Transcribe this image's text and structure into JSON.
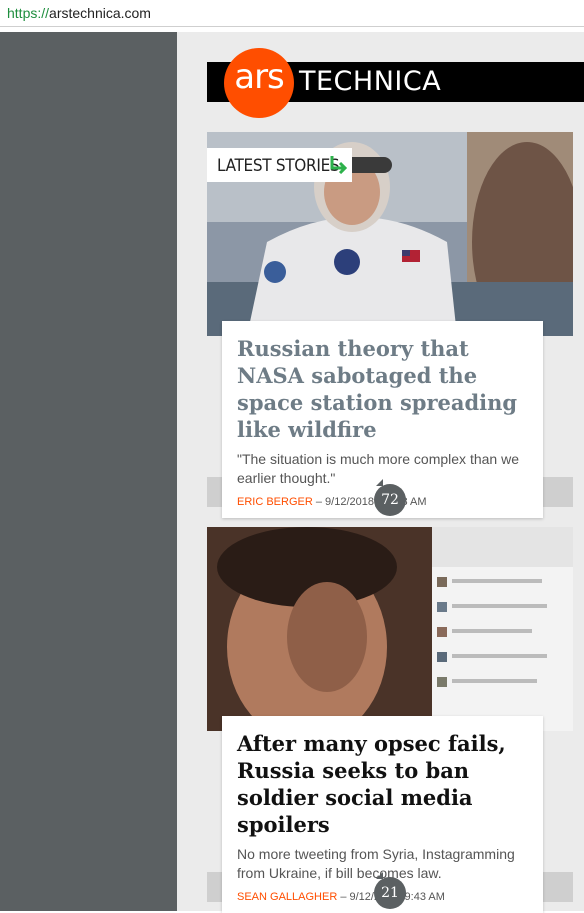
{
  "browser": {
    "url_scheme": "https://",
    "url_host": "arstechnica.com"
  },
  "logo": {
    "ars": "ars",
    "technica": "TECHNICA"
  },
  "section_label": "LATEST STORIES",
  "colors": {
    "brand_orange": "#ff4e00",
    "sidebar": "#5b6062"
  },
  "articles": [
    {
      "headline": "Russian theory that NASA sabotaged the space station spreading like wildfire",
      "dek": "\"The situation is much more complex than we earlier thought.\"",
      "author": "ERIC BERGER",
      "separator": " – ",
      "date": "9/12/2018, 10:18 AM",
      "comment_count": "72",
      "image_desc_icon": "astronaut-photo"
    },
    {
      "headline": "After many opsec fails, Russia seeks to ban soldier social media spoilers",
      "dek": "No more tweeting from Syria, Instagramming from Ukraine, if bill becomes law.",
      "author": "SEAN GALLAGHER",
      "separator": " – ",
      "date": "9/12/2018, 9:43 AM",
      "comment_count": "21",
      "image_desc_icon": "soldier-selfie-photo"
    }
  ]
}
